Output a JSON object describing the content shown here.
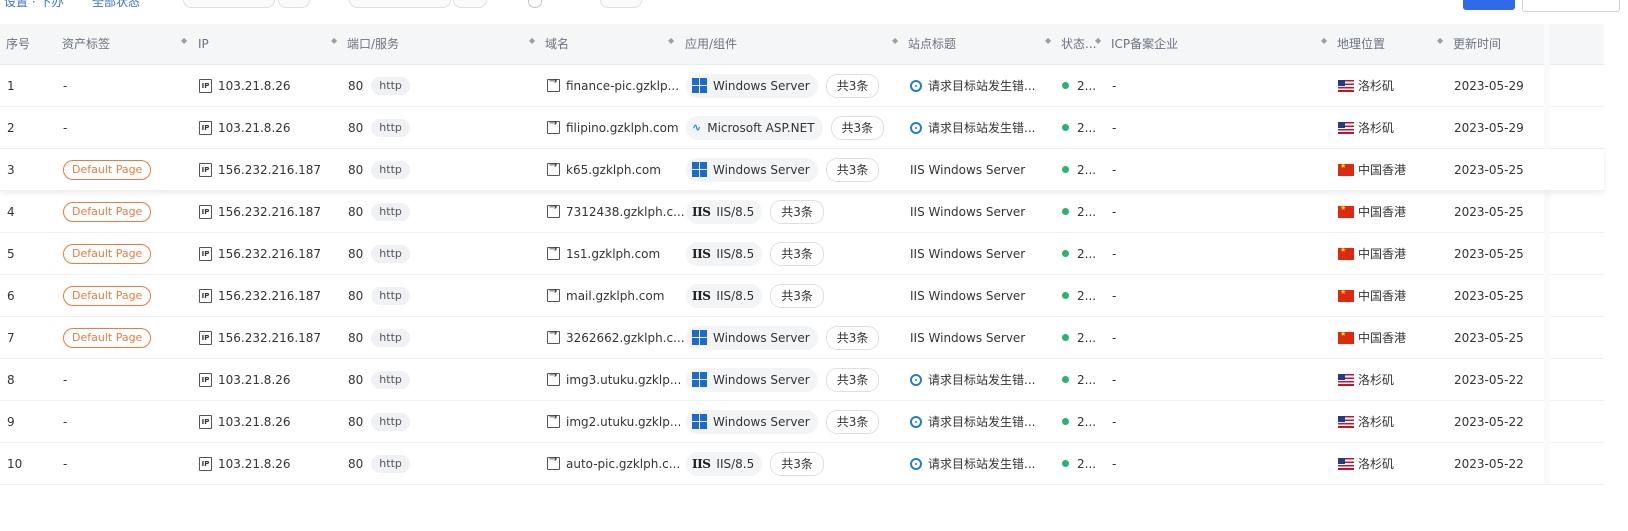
{
  "filters": {
    "link1": "设置 · 下办",
    "link2": "全部状态"
  },
  "columns": {
    "index": "序号",
    "tag": "资产标签",
    "ip": "IP",
    "port": "端口/服务",
    "domain": "域名",
    "app": "应用/组件",
    "title": "站点标题",
    "status": "状态...",
    "icp": "ICP备案企业",
    "geo": "地理位置",
    "updated": "更新时间"
  },
  "rows": [
    {
      "index": "1",
      "tag": "-",
      "tag_type": "none",
      "ip": "103.21.8.26",
      "port": "80",
      "proto": "http",
      "domain": "finance-pic.gzklp...",
      "app_icon": "windows-icon",
      "app": "Windows Server",
      "more": "共3条",
      "title_icon": "error-icon",
      "title": "请求目标站发生错...",
      "status": "2...",
      "icp": "-",
      "flag": "us",
      "geo": "洛杉矶",
      "updated": "2023-05-29"
    },
    {
      "index": "2",
      "tag": "-",
      "tag_type": "none",
      "ip": "103.21.8.26",
      "port": "80",
      "proto": "http",
      "domain": "filipino.gzklph.com",
      "app_icon": "microsoft-aspnet-icon",
      "app": "Microsoft ASP.NET",
      "more": "共3条",
      "title_icon": "error-icon",
      "title": "请求目标站发生错...",
      "status": "2...",
      "icp": "-",
      "flag": "us",
      "geo": "洛杉矶",
      "updated": "2023-05-29"
    },
    {
      "index": "3",
      "tag": "Default Page",
      "tag_type": "default",
      "ip": "156.232.216.187",
      "port": "80",
      "proto": "http",
      "domain": "k65.gzklph.com",
      "app_icon": "windows-icon",
      "app": "Windows Server",
      "more": "共3条",
      "title_icon": "",
      "title": "IIS Windows Server",
      "status": "2...",
      "icp": "-",
      "flag": "cn",
      "geo": "中国香港",
      "updated": "2023-05-25"
    },
    {
      "index": "4",
      "tag": "Default Page",
      "tag_type": "default",
      "ip": "156.232.216.187",
      "port": "80",
      "proto": "http",
      "domain": "7312438.gzklph.c...",
      "app_icon": "iis-icon",
      "app": "IIS/8.5",
      "more": "共3条",
      "title_icon": "",
      "title": "IIS Windows Server",
      "status": "2...",
      "icp": "-",
      "flag": "cn",
      "geo": "中国香港",
      "updated": "2023-05-25"
    },
    {
      "index": "5",
      "tag": "Default Page",
      "tag_type": "default",
      "ip": "156.232.216.187",
      "port": "80",
      "proto": "http",
      "domain": "1s1.gzklph.com",
      "app_icon": "iis-icon",
      "app": "IIS/8.5",
      "more": "共3条",
      "title_icon": "",
      "title": "IIS Windows Server",
      "status": "2...",
      "icp": "-",
      "flag": "cn",
      "geo": "中国香港",
      "updated": "2023-05-25"
    },
    {
      "index": "6",
      "tag": "Default Page",
      "tag_type": "default",
      "ip": "156.232.216.187",
      "port": "80",
      "proto": "http",
      "domain": "mail.gzklph.com",
      "app_icon": "iis-icon",
      "app": "IIS/8.5",
      "more": "共3条",
      "title_icon": "",
      "title": "IIS Windows Server",
      "status": "2...",
      "icp": "-",
      "flag": "cn",
      "geo": "中国香港",
      "updated": "2023-05-25"
    },
    {
      "index": "7",
      "tag": "Default Page",
      "tag_type": "default",
      "ip": "156.232.216.187",
      "port": "80",
      "proto": "http",
      "domain": "3262662.gzklph.c...",
      "app_icon": "windows-icon",
      "app": "Windows Server",
      "more": "共3条",
      "title_icon": "",
      "title": "IIS Windows Server",
      "status": "2...",
      "icp": "-",
      "flag": "cn",
      "geo": "中国香港",
      "updated": "2023-05-25"
    },
    {
      "index": "8",
      "tag": "-",
      "tag_type": "none",
      "ip": "103.21.8.26",
      "port": "80",
      "proto": "http",
      "domain": "img3.utuku.gzklp...",
      "app_icon": "windows-icon",
      "app": "Windows Server",
      "more": "共3条",
      "title_icon": "error-icon",
      "title": "请求目标站发生错...",
      "status": "2...",
      "icp": "-",
      "flag": "us",
      "geo": "洛杉矶",
      "updated": "2023-05-22"
    },
    {
      "index": "9",
      "tag": "-",
      "tag_type": "none",
      "ip": "103.21.8.26",
      "port": "80",
      "proto": "http",
      "domain": "img2.utuku.gzklp...",
      "app_icon": "windows-icon",
      "app": "Windows Server",
      "more": "共3条",
      "title_icon": "error-icon",
      "title": "请求目标站发生错...",
      "status": "2...",
      "icp": "-",
      "flag": "us",
      "geo": "洛杉矶",
      "updated": "2023-05-22"
    },
    {
      "index": "10",
      "tag": "-",
      "tag_type": "none",
      "ip": "103.21.8.26",
      "port": "80",
      "proto": "http",
      "domain": "auto-pic.gzklph.c...",
      "app_icon": "iis-icon",
      "app": "IIS/8.5",
      "more": "共3条",
      "title_icon": "error-icon",
      "title": "请求目标站发生错...",
      "status": "2...",
      "icp": "-",
      "flag": "us",
      "geo": "洛杉矶",
      "updated": "2023-05-22"
    }
  ],
  "colors": {
    "accent": "#2f6be8",
    "tag_orange": "#f07a3a",
    "status_green": "#22b573"
  }
}
